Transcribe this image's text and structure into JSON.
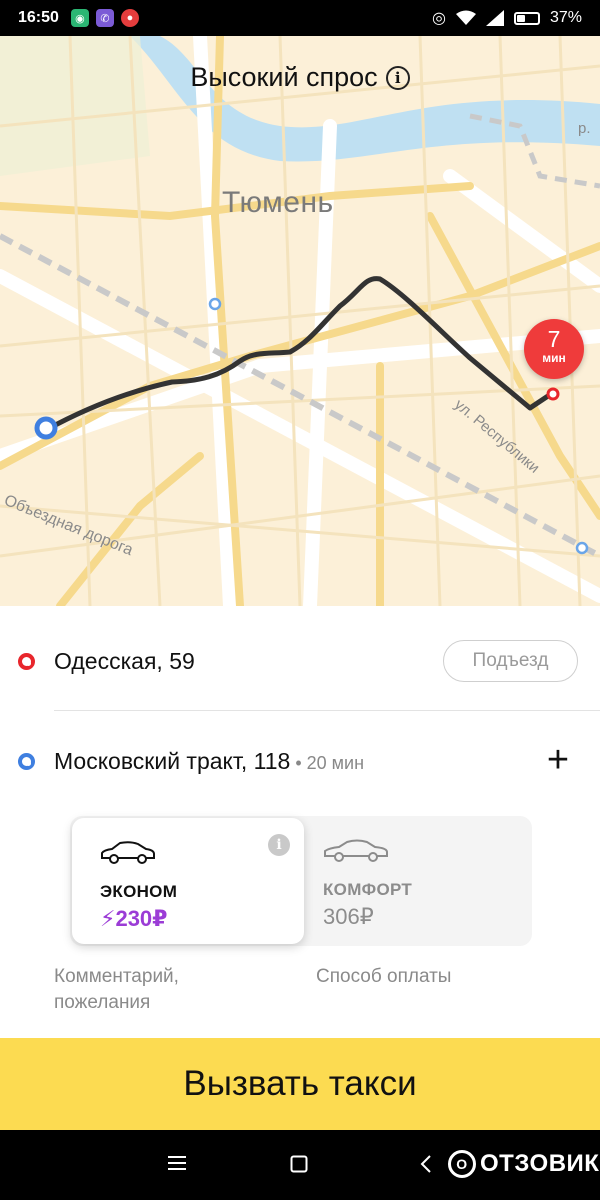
{
  "status_bar": {
    "time": "16:50",
    "battery": "37%",
    "battery_fraction": 0.37,
    "app_icons": [
      "vpn-icon",
      "viber-icon",
      "app-icon"
    ],
    "status_icons": [
      "hotspot-icon",
      "wifi-icon",
      "signal-icon",
      "battery-icon"
    ]
  },
  "map": {
    "title": "Высокий спрос",
    "info_icon": "i",
    "city": "Тюмень",
    "road_labels": {
      "street": "ул. Республики",
      "bypass": "Объездная дорога",
      "river": "р."
    },
    "eta": {
      "value": "7",
      "unit": "мин"
    },
    "colors": {
      "route": "#333333",
      "eta_badge": "#ef3b3b",
      "origin": "#3f7fe0",
      "destination": "#e8262c"
    }
  },
  "route": {
    "pickup": {
      "address": "Одесская, 59",
      "entrance_label": "Подъезд"
    },
    "destination": {
      "address": "Московский тракт, 118",
      "duration": " • 20 мин"
    },
    "add_stop_label": "+"
  },
  "tariffs": [
    {
      "name": "ЭКОНОМ",
      "price": "230₽",
      "surge_icon": "⚡",
      "selected": true,
      "info": "i"
    },
    {
      "name": "КОМФОРТ",
      "price": "306₽",
      "selected": false
    }
  ],
  "options": {
    "comment": "Комментарий, пожелания",
    "payment": "Способ оплаты"
  },
  "call_button": {
    "label": "Вызвать такси"
  },
  "nav_bar": {
    "watermark": "ОТЗОВИК",
    "watermark_symbol": "О"
  }
}
